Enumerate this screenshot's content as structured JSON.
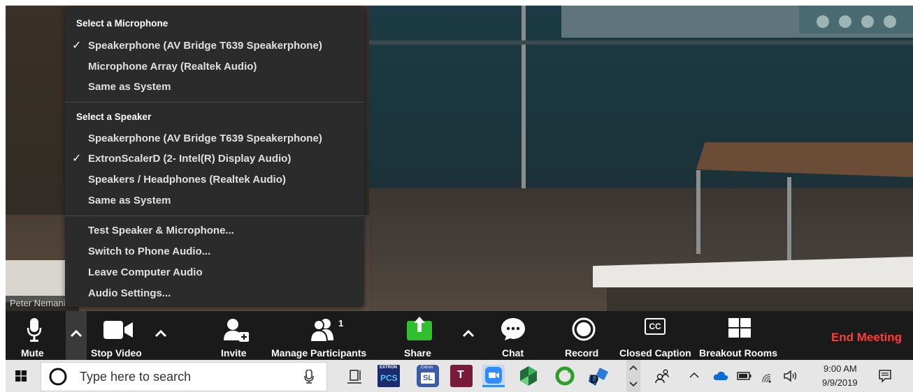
{
  "video": {
    "participant_name": "Peter Nemanich"
  },
  "audio_menu": {
    "microphone_header": "Select a Microphone",
    "microphones": [
      {
        "label": "Speakerphone (AV Bridge T639 Speakerphone)",
        "checked": true
      },
      {
        "label": "Microphone Array (Realtek Audio)",
        "checked": false
      },
      {
        "label": "Same as System",
        "checked": false
      }
    ],
    "speaker_header": "Select a Speaker",
    "speakers": [
      {
        "label": "Speakerphone (AV Bridge T639 Speakerphone)",
        "checked": false
      },
      {
        "label": "ExtronScalerD (2- Intel(R) Display Audio)",
        "checked": true
      },
      {
        "label": "Speakers / Headphones (Realtek Audio)",
        "checked": false
      },
      {
        "label": "Same as System",
        "checked": false
      }
    ],
    "actions": [
      "Test Speaker & Microphone...",
      "Switch to Phone Audio...",
      "Leave Computer Audio",
      "Audio Settings..."
    ],
    "check_glyph": "✓"
  },
  "toolbar": {
    "mute_label": "Mute",
    "stop_video_label": "Stop Video",
    "invite_label": "Invite",
    "manage_participants_label": "Manage Participants",
    "participants_count": "1",
    "share_label": "Share",
    "chat_label": "Chat",
    "record_label": "Record",
    "closed_caption_label": "Closed Caption",
    "cc_icon_text": "CC",
    "breakout_rooms_label": "Breakout Rooms",
    "end_meeting_label": "End Meeting",
    "end_meeting_color": "#ff3b3b",
    "share_color": "#2fbf2f"
  },
  "taskbar": {
    "search_placeholder": "Type here to search",
    "pinned_apps": [
      {
        "name": "task-view-icon"
      },
      {
        "name": "extron-pcs-icon",
        "text": "PCS",
        "caption": "EXTRON"
      },
      {
        "name": "extron-sl-icon",
        "text": "SL",
        "caption": "Extron"
      },
      {
        "name": "teams-icon",
        "text": "T"
      },
      {
        "name": "zoom-icon"
      },
      {
        "name": "app-green-icon"
      },
      {
        "name": "app-refresh-icon"
      },
      {
        "name": "app-d-icon",
        "text": "D"
      }
    ],
    "time": "9:00 AM",
    "date": "9/9/2019"
  }
}
